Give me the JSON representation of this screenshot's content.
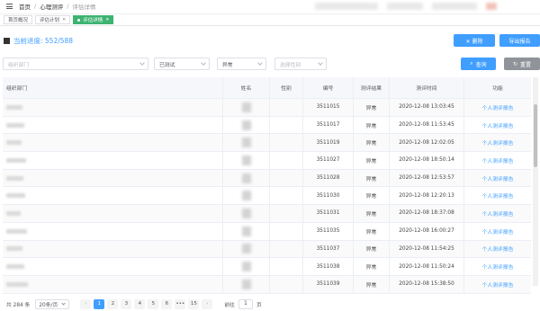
{
  "breadcrumb": {
    "home": "首页",
    "section": "心理测评",
    "current": "评估详情"
  },
  "tabs": [
    {
      "label": "首页概况",
      "active": false
    },
    {
      "label": "评估计划",
      "active": false
    },
    {
      "label": "评估详情",
      "active": true
    }
  ],
  "progress": {
    "label": "当前进度: 552/588"
  },
  "buttons": {
    "delete": "✕ 删除",
    "export": "导出报告",
    "query": "查询",
    "reset": "重置"
  },
  "filters": {
    "dept_placeholder": "组织部门",
    "status_value": "已测试",
    "result_value": "异常",
    "gender_placeholder": "选择性别"
  },
  "table": {
    "headers": {
      "dept": "组织部门",
      "name": "姓名",
      "gender": "性别",
      "no": "编号",
      "result": "测评结果",
      "time": "测评时间",
      "func": "功能"
    },
    "rows": [
      {
        "no": "3511015",
        "result": "异常",
        "time": "2020-12-08 13:03:45",
        "action": "个人测评报告"
      },
      {
        "no": "3511017",
        "result": "异常",
        "time": "2020-12-08 11:53:45",
        "action": "个人测评报告"
      },
      {
        "no": "3511019",
        "result": "异常",
        "time": "2020-12-08 12:02:05",
        "action": "个人测评报告"
      },
      {
        "no": "3511027",
        "result": "异常",
        "time": "2020-12-08 18:50:14",
        "action": "个人测评报告"
      },
      {
        "no": "3511028",
        "result": "异常",
        "time": "2020-12-08 12:53:57",
        "action": "个人测评报告"
      },
      {
        "no": "3511030",
        "result": "异常",
        "time": "2020-12-08 12:20:13",
        "action": "个人测评报告"
      },
      {
        "no": "3511031",
        "result": "异常",
        "time": "2020-12-08 18:37:08",
        "action": "个人测评报告"
      },
      {
        "no": "3511035",
        "result": "异常",
        "time": "2020-12-08 16:00:27",
        "action": "个人测评报告"
      },
      {
        "no": "3511037",
        "result": "异常",
        "time": "2020-12-08 11:54:25",
        "action": "个人测评报告"
      },
      {
        "no": "3511038",
        "result": "异常",
        "time": "2020-12-08 11:50:24",
        "action": "个人测评报告"
      },
      {
        "no": "3511039",
        "result": "异常",
        "time": "2020-12-08 15:38:50",
        "action": "个人测评报告"
      }
    ]
  },
  "pagination": {
    "total": "共 284 条",
    "page_size": "20条/页",
    "pages": [
      "1",
      "2",
      "3",
      "4",
      "5",
      "6",
      "•••",
      "15"
    ],
    "goto_label": "前往",
    "goto_value": "1",
    "goto_suffix": "页"
  }
}
